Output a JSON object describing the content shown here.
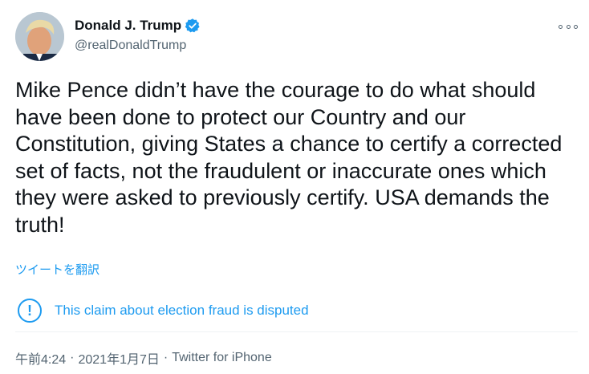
{
  "author": {
    "display_name": "Donald J. Trump",
    "handle": "@realDonaldTrump",
    "verified_icon": "verified-badge-icon",
    "avatar_icon": "profile-photo"
  },
  "more_icon": "more-options-icon",
  "tweet": {
    "text": "Mike Pence didn’t have the courage to do what should have been done to protect our Country and our Constitution, giving States a chance to certify a corrected set of facts, not the fraudulent or inaccurate ones which they were asked to previously certify. USA demands the truth!"
  },
  "translate_label": "ツイートを翻訳",
  "notice": {
    "icon": "exclamation-circle-icon",
    "text": "This claim about election fraud is disputed"
  },
  "meta": {
    "time": "午前4:24",
    "separator": "·",
    "date": "2021年1月7日",
    "source": "Twitter for iPhone"
  },
  "colors": {
    "accent": "#1d9bf0",
    "text": "#0f1419",
    "muted": "#536471"
  }
}
